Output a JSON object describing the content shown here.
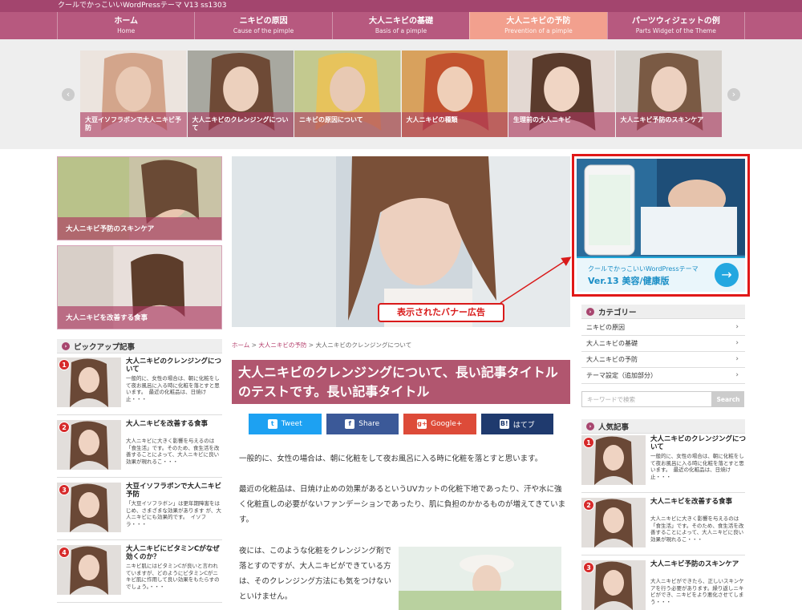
{
  "site": {
    "title": "クールでかっこいいWordPressテーマ V13 ss1303"
  },
  "nav": [
    {
      "ja": "ホーム",
      "en": "Home",
      "active": false
    },
    {
      "ja": "ニキビの原因",
      "en": "Cause of the pimple",
      "active": false
    },
    {
      "ja": "大人ニキビの基礎",
      "en": "Basis of a pimple",
      "active": false
    },
    {
      "ja": "大人ニキビの予防",
      "en": "Prevention of a pimple",
      "active": true
    },
    {
      "ja": "パーツウィジェットの例",
      "en": "Parts Widget of the Theme",
      "active": false
    }
  ],
  "slider": {
    "prev_icon": "chevron-left-icon",
    "next_icon": "chevron-right-icon",
    "slides": [
      {
        "caption": "大豆イソフラボンで大人ニキビ予防"
      },
      {
        "caption": "大人ニキビのクレンジングについて"
      },
      {
        "caption": "ニキビの原因について"
      },
      {
        "caption": "大人ニキビの種類"
      },
      {
        "caption": "生理前の大人ニキビ"
      },
      {
        "caption": "大人ニキビ予防のスキンケア"
      }
    ]
  },
  "left": {
    "banners": [
      {
        "caption": "大人ニキビ予防のスキンケア"
      },
      {
        "caption": "大人ニキビを改善する食事"
      }
    ],
    "pickup_heading": "ピックアップ記事",
    "pickup": [
      {
        "num": "1",
        "title": "大人ニキビのクレンジングについて",
        "excerpt": "一般的に、女性の場合は、朝に化粧をして夜お風呂に入る時に化粧を落とすと思います。　最近の化粧品は、日焼け止・・・"
      },
      {
        "num": "2",
        "title": "大人ニキビを改善する食事",
        "excerpt": "大人ニキビに大きく影響を与えるのは「食生活」です。そのため、食生活を改善することによって、大人ニキビに良い効果が現れるこ・・・"
      },
      {
        "num": "3",
        "title": "大豆イソフラボンで大人ニキビ予防",
        "excerpt": "「大豆イソフラボン」は更年期障害をはじめ、さまざまな効果があります が、大人ニキビにも効果的です。　イソフラ・・・"
      },
      {
        "num": "4",
        "title": "大人ニキビにビタミンCがなぜ効くのか？",
        "excerpt": "ニキビ肌にはビタミンCが良いと言われていますが、どのようにビタミンCがニキビ肌に作用して良い効果をもたらすのでしょう。・・・"
      }
    ]
  },
  "main": {
    "callout": "表示されたバナー広告",
    "breadcrumb": {
      "home": "ホーム",
      "sep": ">",
      "cat": "大人ニキビの予防",
      "current": "大人ニキビのクレンジングについて"
    },
    "title": "大人ニキビのクレンジングについて、長い記事タイトルのテストです。長い記事タイトル",
    "share": [
      {
        "label": "Tweet",
        "icon": "twitter-icon",
        "glyph": "t",
        "color": "#1da1f2"
      },
      {
        "label": "Share",
        "icon": "facebook-icon",
        "glyph": "f",
        "color": "#3b5998"
      },
      {
        "label": "Google+",
        "icon": "google-plus-icon",
        "glyph": "g+",
        "color": "#dd4b39"
      },
      {
        "label": "はてブ",
        "icon": "hatena-icon",
        "glyph": "B!",
        "color": "#1f3a6e"
      }
    ],
    "paragraphs": [
      "一般的に、女性の場合は、朝に化粧をして夜お風呂に入る時に化粧を落とすと思います。",
      "最近の化粧品は、日焼け止めの効果があるというUVカットの化粧下地であったり、汗や水に強く化粧直しの必要がないファンデーションであったり、肌に負担のかかるものが増えてきています。",
      "夜には、このような化粧をクレンジング剤で落とすのですが、大人ニキビができている方は、そのクレンジング方法にも気をつけないといけません。"
    ]
  },
  "right": {
    "ad": {
      "line1": "クールでかっこいいWordPressテーマ",
      "line2": "Ver.13 美容/健康版",
      "go_icon": "arrow-right-icon"
    },
    "category_heading": "カテゴリー",
    "categories": [
      "ニキビの原因",
      "大人ニキビの基礎",
      "大人ニキビの予防",
      "テーマ設定（追加部分）"
    ],
    "search": {
      "placeholder": "キーワードで検索",
      "button": "Search"
    },
    "popular_heading": "人気記事",
    "popular": [
      {
        "num": "1",
        "title": "大人ニキビのクレンジングについて",
        "excerpt": "一般的に、女性の場合は、朝に化粧をして夜お風呂に入る時に化粧を落とすと思います。　最近の化粧品は、日焼け止・・・"
      },
      {
        "num": "2",
        "title": "大人ニキビを改善する食事",
        "excerpt": "大人ニキビに大きく影響を与えるのは「食生活」です。そのため、食生活を改善することによって、大人ニキビに良い効果が現れるこ・・・"
      },
      {
        "num": "3",
        "title": "大人ニキビ予防のスキンケア",
        "excerpt": "大人ニキビができたら、正しいスキンケアを行う必要があります。繰り返しニキビができ、ニキビをより悪化させてしまう・・・"
      }
    ]
  }
}
